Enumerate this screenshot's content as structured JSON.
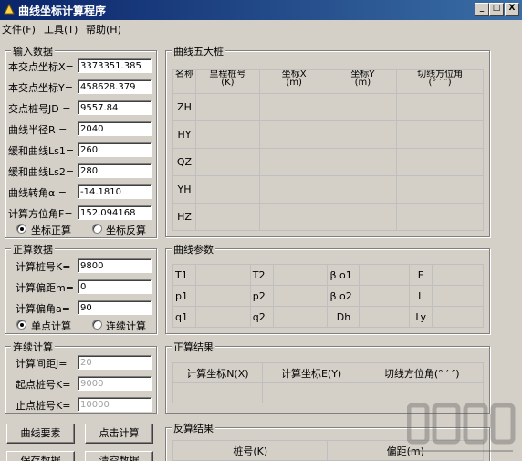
{
  "window": {
    "title": "曲线坐标计算程序",
    "minimize": "_",
    "maximize": "□",
    "close": "X"
  },
  "menu": [
    "文件(F)",
    "工具(T)",
    "帮助(H)"
  ],
  "input": {
    "title": "输入数据",
    "rows": [
      {
        "label": "本交点坐标X=",
        "value": "3373351.385"
      },
      {
        "label": "本交点坐标Y=",
        "value": "458628.379"
      },
      {
        "label": "交点桩号JD =",
        "value": "9557.84"
      },
      {
        "label": "曲线半径R =",
        "value": "2040"
      },
      {
        "label": "缓和曲线Ls1=",
        "value": "260"
      },
      {
        "label": "缓和曲线Ls2=",
        "value": "280"
      },
      {
        "label": "曲线转角α =",
        "value": "-14.1810"
      },
      {
        "label": "计算方位角F=",
        "value": "152.094168"
      }
    ],
    "radio_forward": "坐标正算",
    "radio_inverse": "坐标反算"
  },
  "forward": {
    "title": "正算数据",
    "rows": [
      {
        "label": "计算桩号K=",
        "value": "9800"
      },
      {
        "label": "计算偏距m=",
        "value": "0"
      },
      {
        "label": "计算偏角a=",
        "value": "90"
      }
    ],
    "radio_single": "单点计算",
    "radio_continuous": "连续计算"
  },
  "continuous": {
    "title": "连续计算",
    "rows": [
      {
        "label": "计算间距J=",
        "value": "20"
      },
      {
        "label": "起点桩号K=",
        "value": "9000"
      },
      {
        "label": "止点桩号K=",
        "value": "10000"
      }
    ]
  },
  "buttons": {
    "curve_elements": "曲线要素",
    "point_calc": "点击计算",
    "save_data": "保存数据",
    "clear_data": "清空数据"
  },
  "five_piles": {
    "title": "曲线五大桩",
    "headers": [
      "名称",
      "里程桩号\n(K)",
      "坐标X\n(m)",
      "坐标Y\n(m)",
      "切线方位角\n(° ′ ″)"
    ],
    "rows": [
      "ZH",
      "HY",
      "QZ",
      "YH",
      "HZ"
    ]
  },
  "curve_params": {
    "title": "曲线参数",
    "rows": [
      [
        "T1",
        "T2",
        "β o1",
        "E"
      ],
      [
        "p1",
        "p2",
        "β o2",
        "L"
      ],
      [
        "q1",
        "q2",
        "Dh",
        "Ly"
      ]
    ]
  },
  "forward_result": {
    "title": "正算结果",
    "headers": [
      "计算坐标N(X)",
      "计算坐标E(Y)",
      "切线方位角(° ′ ″)"
    ]
  },
  "inverse_result": {
    "title": "反算结果",
    "headers": [
      "桩号(K)",
      "偏距(m)"
    ]
  }
}
